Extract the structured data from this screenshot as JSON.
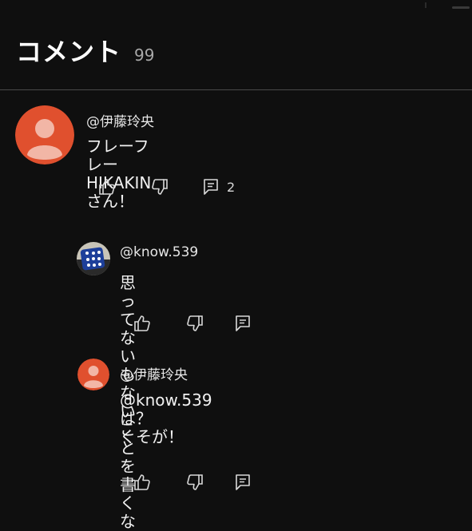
{
  "header": {
    "title": "コメント",
    "count": "99"
  },
  "comments": [
    {
      "author": "@伊藤玲央",
      "text": "フレーフレーHIKAKINさん！",
      "reply_count": "2",
      "avatar_color": "#e0502e"
    }
  ],
  "replies": [
    {
      "author": "@know.539",
      "text": "思ってないもないことを書くな",
      "avatar_color": "#1d3f9a"
    },
    {
      "author": "@伊藤玲央",
      "text": "@know.539\nは？\nくそが！",
      "avatar_color": "#e0502e"
    }
  ],
  "icons": {
    "like": "thumbs-up-icon",
    "dislike": "thumbs-down-icon",
    "reply": "comment-icon"
  },
  "colors": {
    "background": "#0f0f0f",
    "text": "#f1f1f1",
    "secondary": "#a8a8a8"
  }
}
